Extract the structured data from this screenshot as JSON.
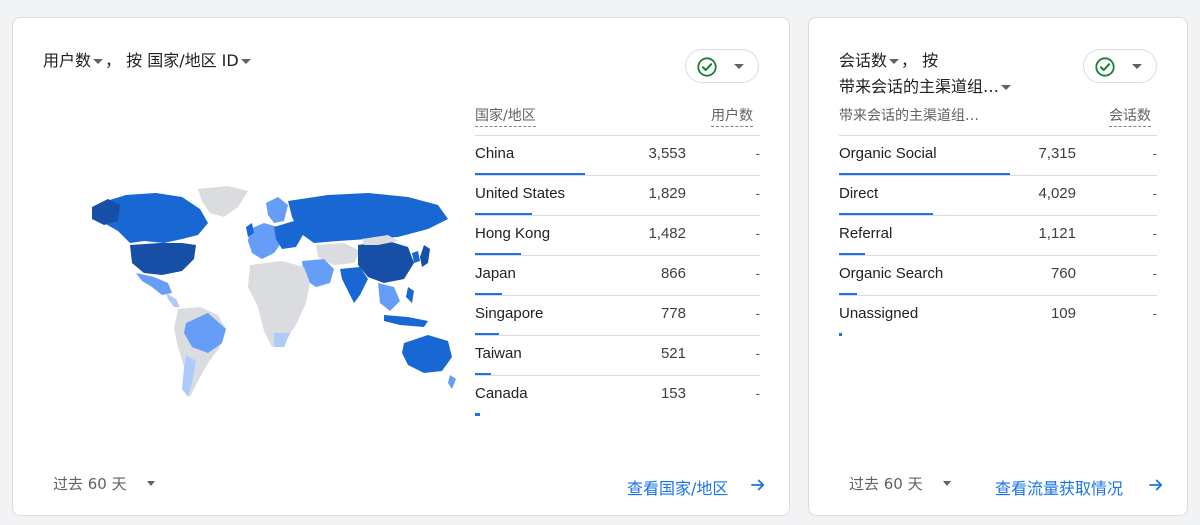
{
  "card1": {
    "title_prefix": "用户数",
    "title_mid": "， 按 国家/地区 ID",
    "col_header_left": "国家/地区",
    "col_header_right": "用户数",
    "rows": [
      {
        "label": "China",
        "value": "3,553",
        "delta": "-",
        "fraction": 1.0
      },
      {
        "label": "United States",
        "value": "1,829",
        "delta": "-",
        "fraction": 0.515
      },
      {
        "label": "Hong Kong",
        "value": "1,482",
        "delta": "-",
        "fraction": 0.417
      },
      {
        "label": "Japan",
        "value": "866",
        "delta": "-",
        "fraction": 0.244
      },
      {
        "label": "Singapore",
        "value": "778",
        "delta": "-",
        "fraction": 0.219
      },
      {
        "label": "Taiwan",
        "value": "521",
        "delta": "-",
        "fraction": 0.147
      },
      {
        "label": "Canada",
        "value": "153",
        "delta": "-",
        "fraction": 0.043
      }
    ],
    "date_range": "过去 60 天",
    "view_link": "查看国家/地区"
  },
  "card2": {
    "title_line1_prefix": "会话数",
    "title_line1_suffix": "， 按",
    "title_line2": "带来会话的主渠道组…",
    "col_header_left": "带来会话的主渠道组…",
    "col_header_right": "会话数",
    "rows": [
      {
        "label": "Organic Social",
        "value": "7,315",
        "delta": "-",
        "fraction": 1.0
      },
      {
        "label": "Direct",
        "value": "4,029",
        "delta": "-",
        "fraction": 0.551
      },
      {
        "label": "Referral",
        "value": "1,121",
        "delta": "-",
        "fraction": 0.153
      },
      {
        "label": "Organic Search",
        "value": "760",
        "delta": "-",
        "fraction": 0.104
      },
      {
        "label": "Unassigned",
        "value": "109",
        "delta": "-",
        "fraction": 0.015
      }
    ],
    "date_range": "过去 60 天",
    "view_link": "查看流量获取情况"
  },
  "colors": {
    "accent": "#1a73e8",
    "map_dark": "#174ea6",
    "map_mid": "#1967d2",
    "map_light": "#669df6",
    "map_pale": "#aecbfa",
    "map_none": "#dadce0",
    "check": "#188038"
  },
  "icons": {
    "compare": "check-circle-icon",
    "dropdown": "caret-down-icon",
    "link": "arrow-right-icon"
  }
}
